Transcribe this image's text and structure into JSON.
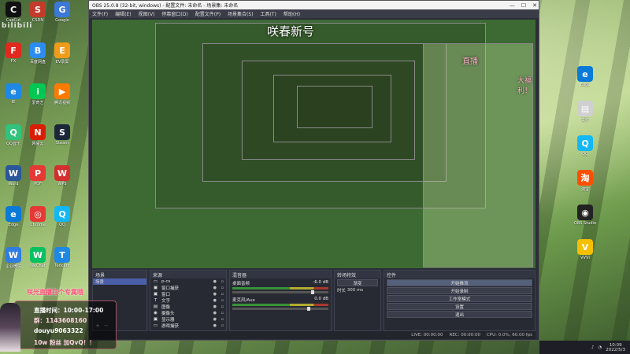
{
  "desktop_left": [
    {
      "label": "CapCut",
      "glyph": "C",
      "color": "#111111"
    },
    {
      "label": "CSDN",
      "glyph": "S",
      "color": "#c33b2b"
    },
    {
      "label": "Google",
      "glyph": "G",
      "color": "#3c78d8"
    },
    {
      "label": "FX",
      "glyph": "F",
      "color": "#e0291f"
    },
    {
      "label": "百度网盘",
      "glyph": "B",
      "color": "#2d8cf0"
    },
    {
      "label": "EV录屏",
      "glyph": "E",
      "color": "#f09b1a"
    },
    {
      "label": "IE",
      "glyph": "e",
      "color": "#1e88e5"
    },
    {
      "label": "爱奇艺",
      "glyph": "i",
      "color": "#00c853"
    },
    {
      "label": "腾讯视频",
      "glyph": "▶",
      "color": "#ff7a00"
    },
    {
      "label": "QQ音乐",
      "glyph": "Q",
      "color": "#31c27c"
    },
    {
      "label": "网易云",
      "glyph": "N",
      "color": "#d81e06"
    },
    {
      "label": "Steam",
      "glyph": "S",
      "color": "#1b2838"
    },
    {
      "label": "Word",
      "glyph": "W",
      "color": "#2b579a"
    },
    {
      "label": "PDF",
      "glyph": "P",
      "color": "#e53935"
    },
    {
      "label": "WPS",
      "glyph": "W",
      "color": "#d32f2f"
    },
    {
      "label": "Edge",
      "glyph": "e",
      "color": "#0a7ad8"
    },
    {
      "label": "Chrome",
      "glyph": "◎",
      "color": "#e53935"
    },
    {
      "label": "QQ",
      "glyph": "Q",
      "color": "#12b7f5"
    },
    {
      "label": "企业微信",
      "glyph": "W",
      "color": "#2f7de1"
    },
    {
      "label": "WeChat",
      "glyph": "W",
      "color": "#07c160"
    },
    {
      "label": "Tencent",
      "glyph": "T",
      "color": "#1e88e5"
    }
  ],
  "desktop_right": [
    {
      "label": "Edge",
      "glyph": "e",
      "color": "#0a7ad8"
    },
    {
      "label": "文件",
      "glyph": "▤",
      "color": "#cfcfcf"
    },
    {
      "label": "QQ",
      "glyph": "Q",
      "color": "#12b7f5"
    },
    {
      "label": "淘宝",
      "glyph": "淘",
      "color": "#ff5000"
    },
    {
      "label": "OBS Studio",
      "glyph": "◉",
      "color": "#222222"
    },
    {
      "label": "VVVI",
      "glyph": "V",
      "color": "#f6c000"
    }
  ],
  "bili_logo": "bilibili",
  "obs": {
    "title": "OBS 25.0.8 (32-bit, windows) - 配置文件: 未命名 - 场景集: 未命名",
    "window_controls": {
      "minimize": "—",
      "maximize": "☐",
      "close": "✕"
    },
    "menu": [
      "文件(F)",
      "编辑(E)",
      "视图(V)",
      "停靠窗口(D)",
      "配置文件(P)",
      "场景集合(S)",
      "工具(T)",
      "帮助(H)"
    ],
    "banner": "咲春新号",
    "banner_right_1": "直播",
    "banner_right_2": "大福利！",
    "scenes": {
      "header": "场景",
      "items": [
        "场景"
      ]
    },
    "sources": {
      "header": "来源",
      "items": [
        {
          "icon": "▭",
          "label": "p-cs"
        },
        {
          "icon": "▣",
          "label": "窗口捕获"
        },
        {
          "icon": "▣",
          "label": "窗口"
        },
        {
          "icon": "T",
          "label": "文字"
        },
        {
          "icon": "▤",
          "label": "图像"
        },
        {
          "icon": "◉",
          "label": "摄像头"
        },
        {
          "icon": "▣",
          "label": "显示器"
        },
        {
          "icon": "▭",
          "label": "游戏捕获"
        }
      ]
    },
    "mixer": {
      "header": "混音器",
      "channels": [
        {
          "label": "桌面音频",
          "db": "-6.0 dB",
          "level": 0.82
        },
        {
          "label": "麦克风/Aux",
          "db": "0.0 dB",
          "level": 0.78
        }
      ]
    },
    "transitions": {
      "header": "转场特效",
      "mode": "渐变",
      "duration_label": "时长",
      "duration": "300 ms"
    },
    "controls": {
      "header": "控件",
      "buttons": [
        "开始推流",
        "开始录制",
        "工作室模式",
        "设置",
        "退出"
      ]
    },
    "status": {
      "live": "LIVE: 00:00:00",
      "rec": "REC: 00:00:00",
      "cpu": "CPU: 0.0%, 60.00 fps"
    }
  },
  "overlay": {
    "title": "咲光直播在个专属哦",
    "time": "直播时间：10:00-17:00",
    "qq": "群：1143608160",
    "douyin": "douyu9063322",
    "fans": "10w 粉丝 加QvQ！！"
  },
  "tray": {
    "time": "10:09",
    "date": "2022/5/3"
  }
}
